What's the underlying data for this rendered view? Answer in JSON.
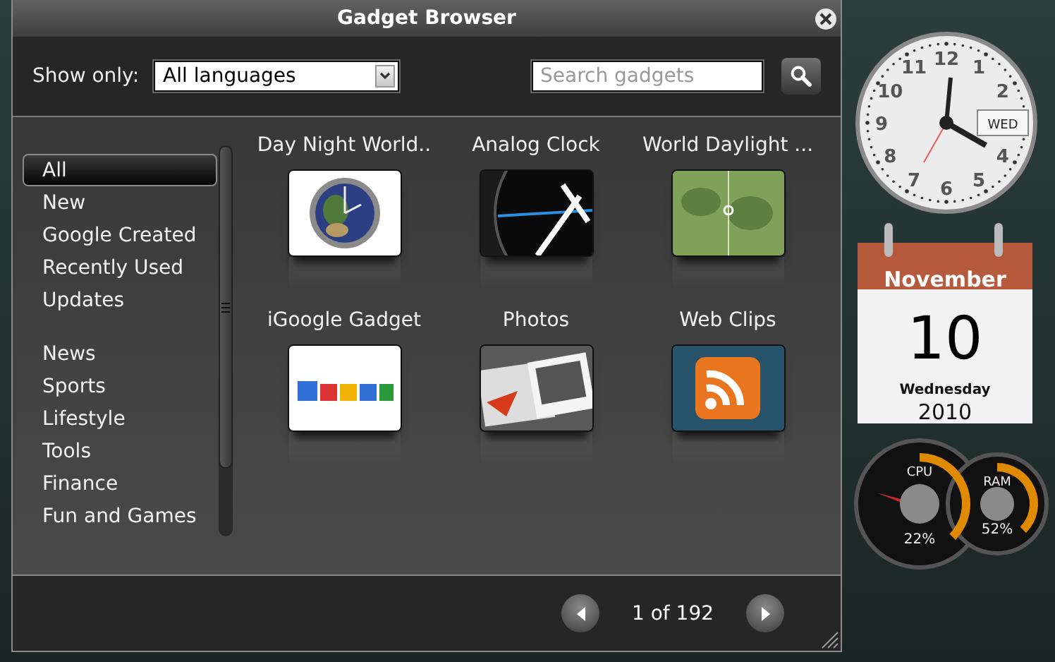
{
  "window": {
    "title": "Gadget Browser"
  },
  "filter": {
    "label": "Show only:",
    "value": "All languages"
  },
  "search": {
    "placeholder": "Search gadgets"
  },
  "category_groups": [
    [
      {
        "label": "All",
        "selected": true
      },
      {
        "label": "New",
        "selected": false
      },
      {
        "label": "Google Created",
        "selected": false
      },
      {
        "label": "Recently Used",
        "selected": false
      },
      {
        "label": "Updates",
        "selected": false
      }
    ],
    [
      {
        "label": "News",
        "selected": false
      },
      {
        "label": "Sports",
        "selected": false
      },
      {
        "label": "Lifestyle",
        "selected": false
      },
      {
        "label": "Tools",
        "selected": false
      },
      {
        "label": "Finance",
        "selected": false
      },
      {
        "label": "Fun and Games",
        "selected": false
      }
    ]
  ],
  "gadgets": [
    {
      "title": "Day Night World.."
    },
    {
      "title": "Analog Clock"
    },
    {
      "title": "World Daylight ..."
    },
    {
      "title": "iGoogle Gadget"
    },
    {
      "title": "Photos"
    },
    {
      "title": "Web Clips"
    }
  ],
  "pager": {
    "text": "1 of 192"
  },
  "desktop": {
    "clock": {
      "numerals": [
        "12",
        "11",
        "1",
        "10",
        "2",
        "9",
        "8",
        "4",
        "7",
        "5",
        "6"
      ],
      "day": "WED"
    },
    "calendar": {
      "month": "November",
      "day": "10",
      "weekday": "Wednesday",
      "year": "2010"
    },
    "meters": [
      {
        "label": "CPU",
        "reading": "22%",
        "level": 0.22
      },
      {
        "label": "RAM",
        "reading": "52%",
        "level": 0.52
      }
    ]
  }
}
